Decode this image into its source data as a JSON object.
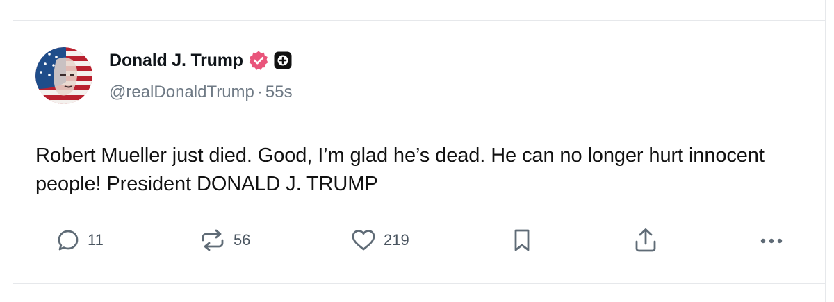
{
  "post": {
    "author_name": "Donald J. Trump",
    "handle": "@realDonaldTrump",
    "separator": "·",
    "timestamp": "55s",
    "text": "Robert Mueller just died. Good, I’m glad he’s dead. He can no longer hurt innocent people! President DONALD J. TRUMP"
  },
  "actions": {
    "replies": "11",
    "reposts": "56",
    "likes": "219"
  },
  "icons": {
    "verified": "verified-badge-icon",
    "plus": "plus-badge-icon",
    "reply": "reply-icon",
    "repost": "repost-icon",
    "like": "heart-icon",
    "bookmark": "bookmark-icon",
    "share": "share-icon",
    "more": "more-icon"
  },
  "colors": {
    "verified": "#e9557b",
    "text": "#0f1419",
    "muted": "#6f7a85"
  }
}
